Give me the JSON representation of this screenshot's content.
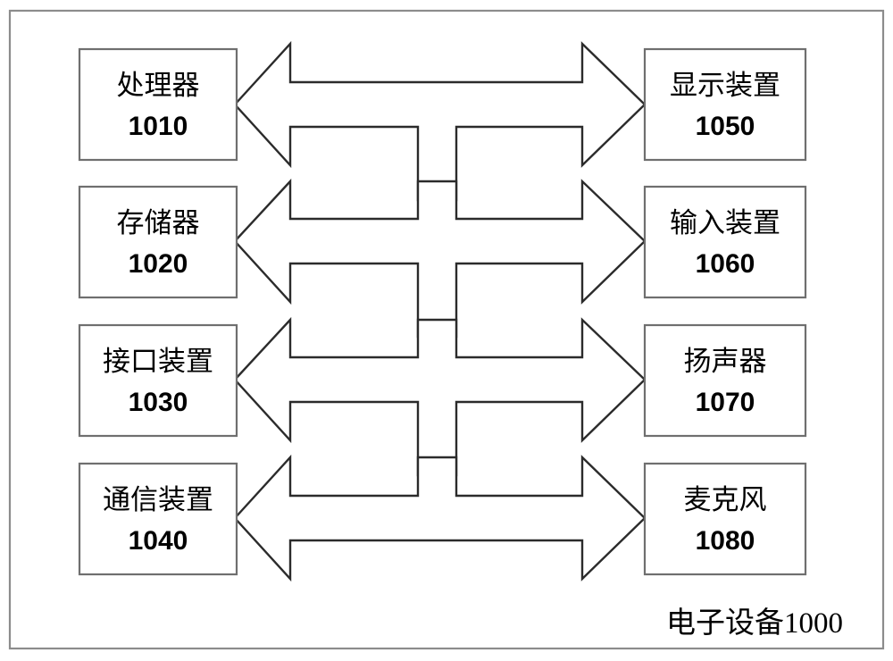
{
  "figure": {
    "caption": "电子设备1000",
    "frame_color": "#8c8c8c",
    "box_border_color": "#6f6f6f",
    "arrow_color": "#2b2b2b",
    "background": "#ffffff"
  },
  "left_column": {
    "nodes": [
      {
        "name_cn": "处理器",
        "ref_num": "1010"
      },
      {
        "name_cn": "存储器",
        "ref_num": "1020"
      },
      {
        "name_cn": "接口装置",
        "ref_num": "1030"
      },
      {
        "name_cn": "通信装置",
        "ref_num": "1040"
      }
    ]
  },
  "right_column": {
    "nodes": [
      {
        "name_cn": "显示装置",
        "ref_num": "1050"
      },
      {
        "name_cn": "输入装置",
        "ref_num": "1060"
      },
      {
        "name_cn": "扬声器",
        "ref_num": "1070"
      },
      {
        "name_cn": "麦克风",
        "ref_num": "1080"
      }
    ]
  },
  "connectors": {
    "description": "bidirectional-bus",
    "rows": 4
  }
}
